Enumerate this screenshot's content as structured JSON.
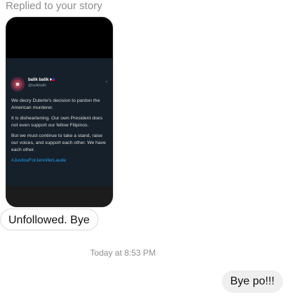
{
  "reply_notice": "Replied to your story",
  "story": {
    "tweet": {
      "display_name": "balik batik",
      "handle": "@balikbatik",
      "menu_icon": "chevron-down-icon",
      "paragraphs": [
        "We decry Duterte's decision to pardon the American murderer.",
        "It is disheartening. Our own President does not even support our fellow Filipinos.",
        "But we must continue to take a stand, raise our voices, and support each other. We have each other."
      ],
      "hashtag": "#JusticeForJenniferLaude"
    }
  },
  "messages": {
    "received": "Unfollowed. Bye",
    "timestamp": "Today at 8:53 PM",
    "sent": "Bye po!!!"
  }
}
